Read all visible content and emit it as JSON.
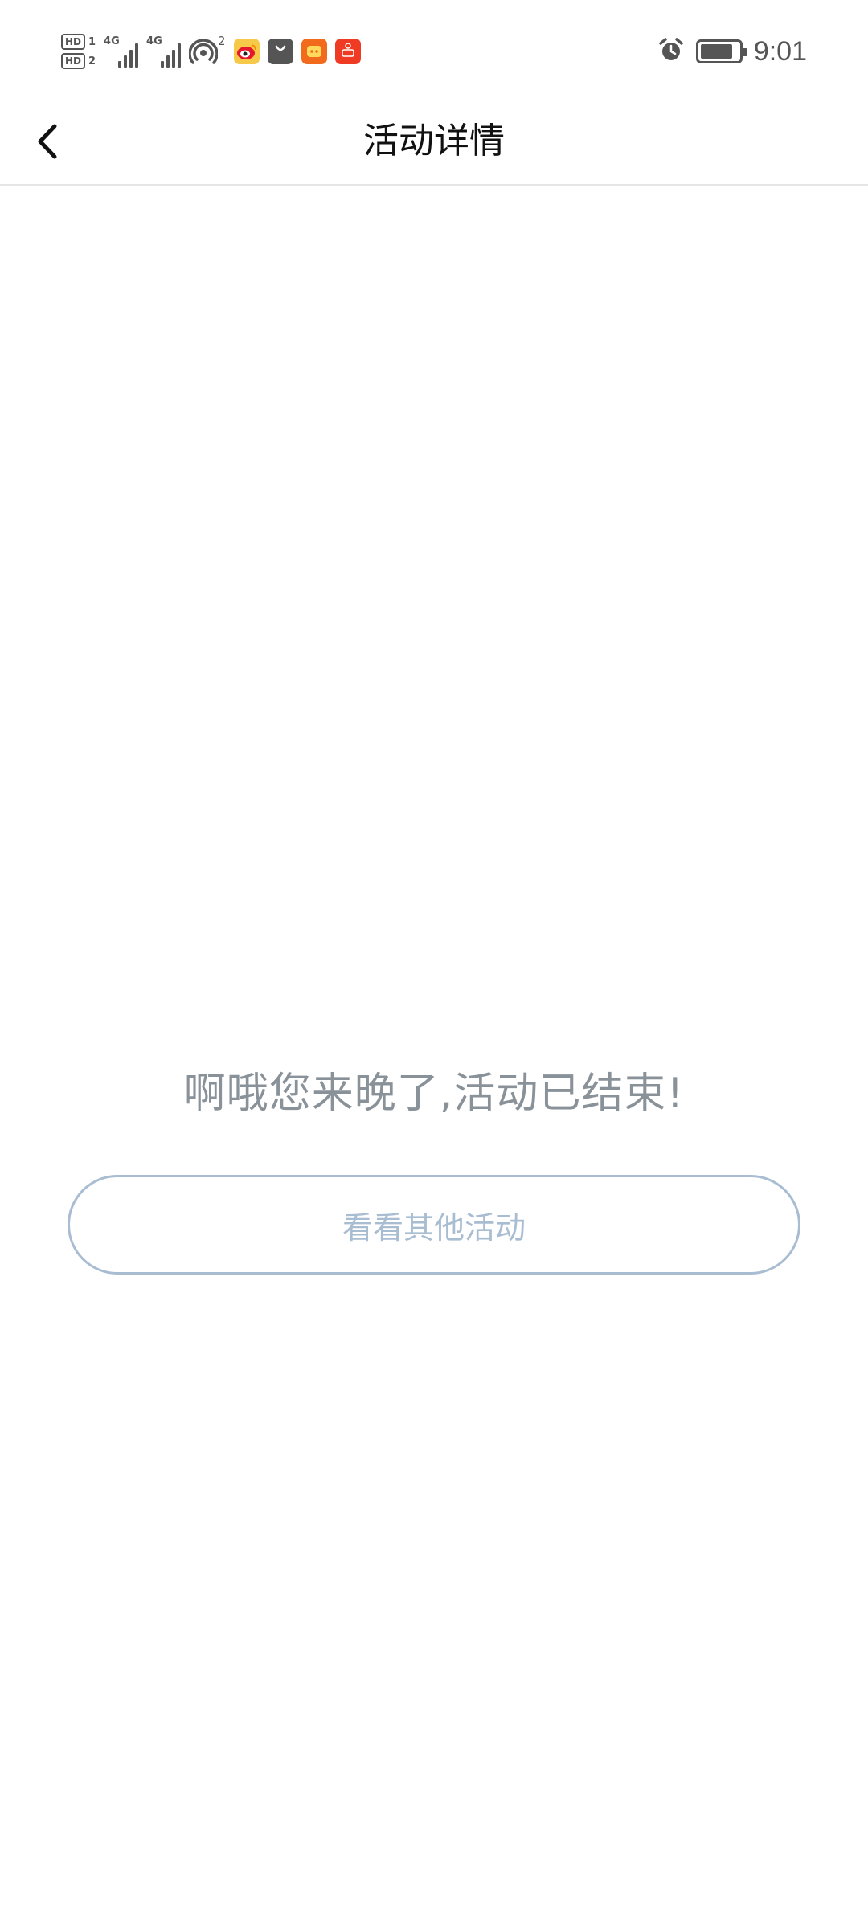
{
  "status_bar": {
    "sim1_label": "HD",
    "sim1_num": "1",
    "sim2_label": "HD",
    "sim2_num": "2",
    "net1": "4G",
    "net2": "4G",
    "hotspot_count": "2",
    "time": "9:01",
    "battery_level": 0.85,
    "icons": [
      "hotspot-icon",
      "weibo-icon",
      "shopping-bag-icon",
      "taobao-icon",
      "app-red-icon",
      "alarm-icon",
      "battery-icon"
    ]
  },
  "nav": {
    "title": "活动详情"
  },
  "empty_state": {
    "message": "啊哦您来晚了,活动已结束!",
    "button_label": "看看其他活动"
  },
  "colors": {
    "message": "#8a9299",
    "button_border": "#a9bdd2",
    "button_text": "#a9bdd2",
    "divider": "#e6e6e6"
  }
}
